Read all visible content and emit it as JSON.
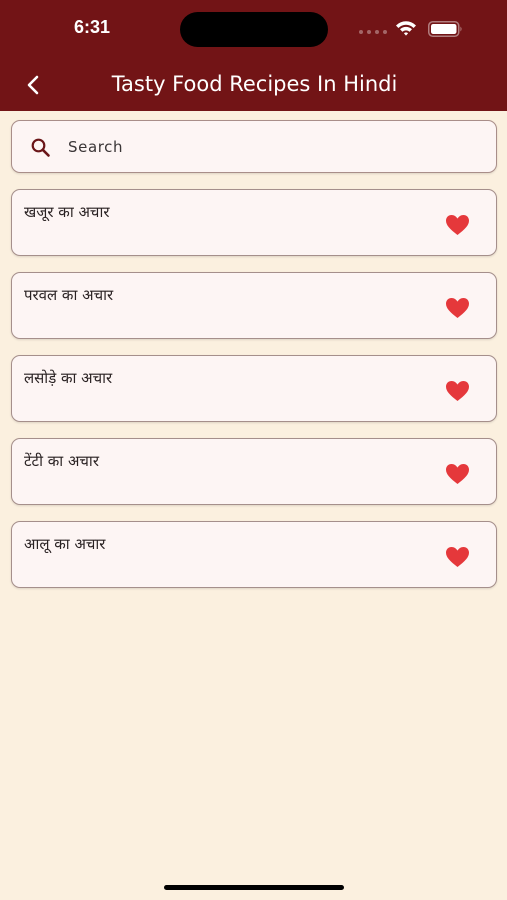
{
  "status_bar": {
    "time": "6:31"
  },
  "header": {
    "title": "Tasty Food Recipes In Hindi",
    "back_icon": "chevron-left-icon"
  },
  "search": {
    "placeholder": "Search",
    "icon": "search-icon"
  },
  "recipes": [
    {
      "title": "खजूर का अचार",
      "favorite": true
    },
    {
      "title": "परवल का अचार",
      "favorite": true
    },
    {
      "title": "लसोड़े का अचार",
      "favorite": true
    },
    {
      "title": "टेंटी का अचार",
      "favorite": true
    },
    {
      "title": "आलू का अचार",
      "favorite": true
    }
  ],
  "colors": {
    "header_bg": "#721416",
    "page_bg": "#fbf0df",
    "card_bg": "#fdf5f4",
    "heart": "#e5383b"
  }
}
